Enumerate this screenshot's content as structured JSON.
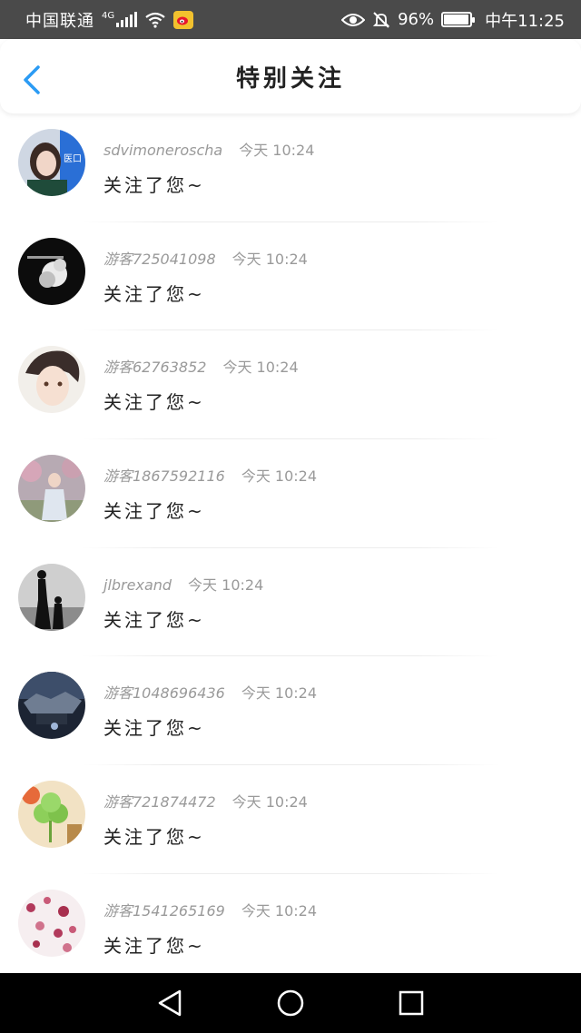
{
  "status_bar": {
    "carrier": "中国联通",
    "network": "4G",
    "battery": "96%",
    "battery_level": 0.96,
    "time": "中午11:25"
  },
  "header": {
    "title": "特别关注",
    "accent_color": "#2b9bf4"
  },
  "items": [
    {
      "username": "sdvimoneroscha",
      "time": "今天 10:24",
      "message": "关注了您~",
      "avatar": "avatar-photo-girl"
    },
    {
      "username": "游客725041098",
      "time": "今天 10:24",
      "message": "关注了您~",
      "avatar": "avatar-bw-art"
    },
    {
      "username": "游客62763852",
      "time": "今天 10:24",
      "message": "关注了您~",
      "avatar": "avatar-anime-boy"
    },
    {
      "username": "游客1867592116",
      "time": "今天 10:24",
      "message": "关注了您~",
      "avatar": "avatar-photo-woman"
    },
    {
      "username": "jlbrexand",
      "time": "今天 10:24",
      "message": "关注了您~",
      "avatar": "avatar-silhouette"
    },
    {
      "username": "游客1048696436",
      "time": "今天 10:24",
      "message": "关注了您~",
      "avatar": "avatar-space-city"
    },
    {
      "username": "游客721874472",
      "time": "今天 10:24",
      "message": "关注了您~",
      "avatar": "avatar-clover"
    },
    {
      "username": "游客1541265169",
      "time": "今天 10:24",
      "message": "关注了您~",
      "avatar": "avatar-flowers"
    }
  ]
}
